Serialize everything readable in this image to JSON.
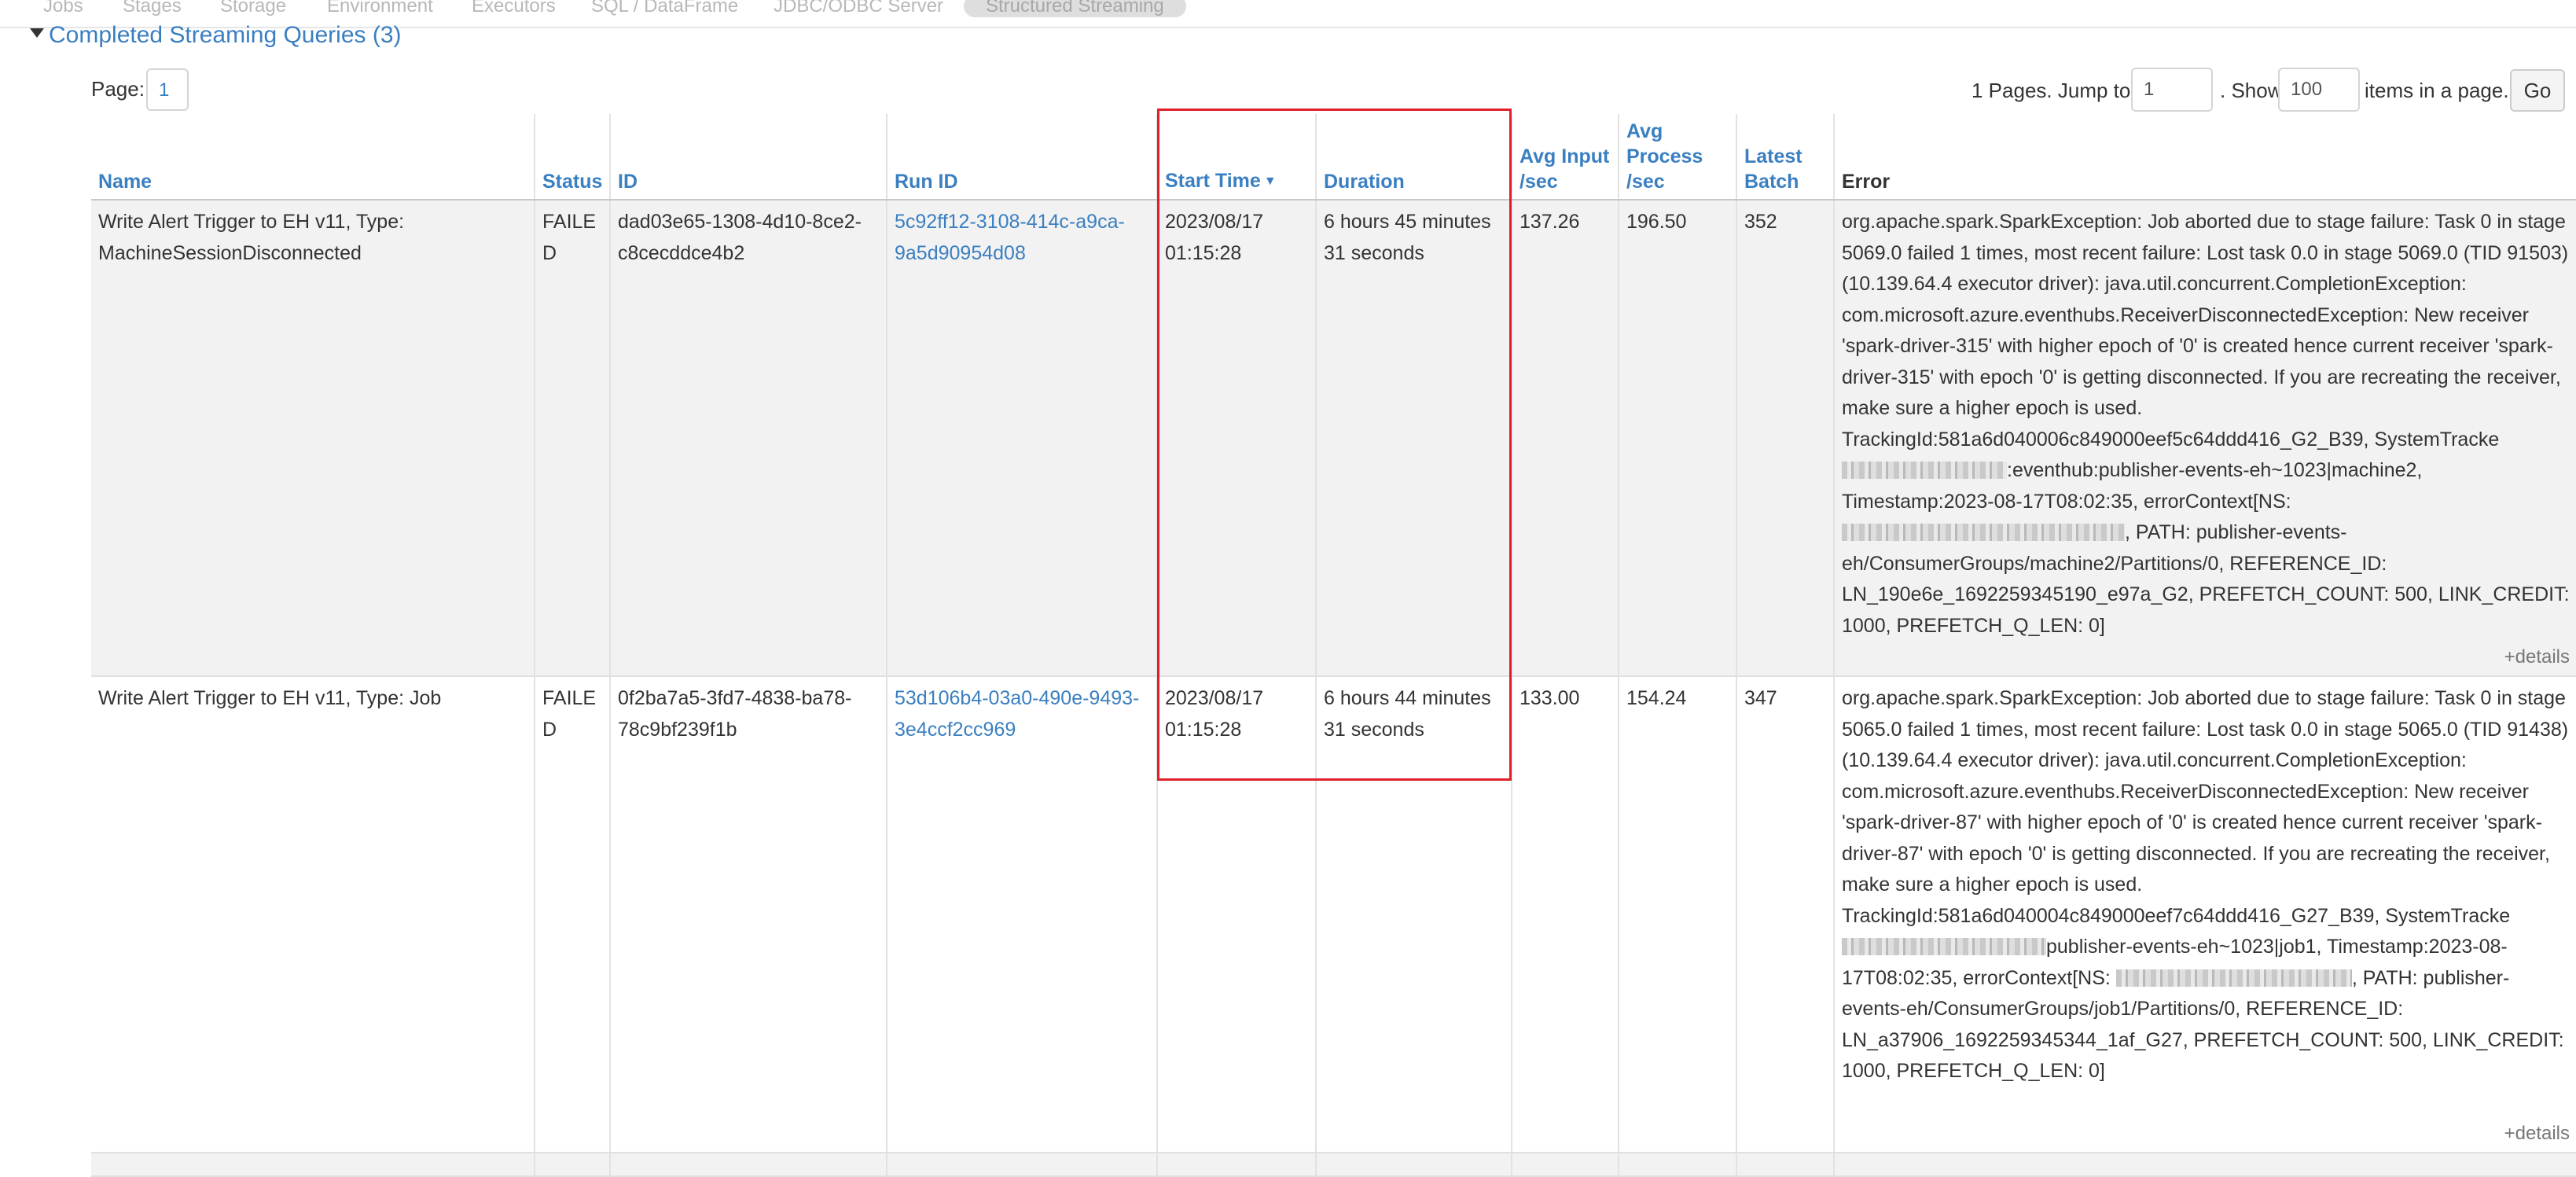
{
  "nav": {
    "tabs": [
      {
        "label": "Jobs"
      },
      {
        "label": "Stages"
      },
      {
        "label": "Storage"
      },
      {
        "label": "Environment"
      },
      {
        "label": "Executors"
      },
      {
        "label": "SQL / DataFrame"
      },
      {
        "label": "JDBC/ODBC Server"
      },
      {
        "label": "Structured Streaming"
      }
    ],
    "active_tab": "Structured Streaming"
  },
  "section": {
    "title": "Completed Streaming Queries (3)"
  },
  "paging": {
    "page_label": "Page:",
    "current_page": "1",
    "pages_text": "1 Pages. Jump to",
    "jump_value": "1",
    "show_text": ". Show",
    "show_value": "100",
    "items_text": "items in a page.",
    "go_label": "Go"
  },
  "table": {
    "headers": {
      "name": "Name",
      "status": "Status",
      "id": "ID",
      "run_id": "Run ID",
      "start_time": "Start Time",
      "sort_indicator": "▼",
      "duration": "Duration",
      "avg_input_1": "Avg Input",
      "avg_input_2": "/sec",
      "avg_process_1": "Avg Process",
      "avg_process_2": "/sec",
      "latest_batch_1": "Latest",
      "latest_batch_2": "Batch",
      "error": "Error"
    },
    "rows": [
      {
        "name": "Write Alert Trigger to EH v11, Type: MachineSessionDisconnected",
        "status": "FAILED",
        "id": "dad03e65-1308-4d10-8ce2-c8cecddce4b2",
        "run_id": "5c92ff12-3108-414c-a9ca-9a5d90954d08",
        "start_time": "2023/08/17 01:15:28",
        "duration": "6 hours 45 minutes 31 seconds",
        "avg_input": "137.26",
        "avg_process": "196.50",
        "latest_batch": "352",
        "error_a": "org.apache.spark.SparkException: Job aborted due to stage failure: Task 0 in stage 5069.0 failed 1 times, most recent failure: Lost task 0.0 in stage 5069.0 (TID 91503) (10.139.64.4 executor driver): java.util.concurrent.CompletionException: com.microsoft.azure.eventhubs.ReceiverDisconnectedException: New receiver 'spark-driver-315' with higher epoch of '0' is created hence current receiver 'spark-driver-315' with epoch '0' is getting disconnected. If you are recreating the receiver, make sure a higher epoch is used. TrackingId:581a6d040006c849000eef5c64ddd416_G2_B39, SystemTracke",
        "error_b": ":eventhub:publisher-events-eh~1023|machine2, Timestamp:2023-08-17T08:02:35, errorContext[NS:",
        "error_c": ", PATH: publisher-events-eh/ConsumerGroups/machine2/Partitions/0, REFERENCE_ID: LN_190e6e_1692259345190_e97a_G2, PREFETCH_COUNT: 500, LINK_CREDIT: 1000, PREFETCH_Q_LEN: 0]",
        "details": "+details"
      },
      {
        "name": "Write Alert Trigger to EH v11, Type: Job",
        "status": "FAILED",
        "id": "0f2ba7a5-3fd7-4838-ba78-78c9bf239f1b",
        "run_id": "53d106b4-03a0-490e-9493-3e4ccf2cc969",
        "start_time": "2023/08/17 01:15:28",
        "duration": "6 hours 44 minutes 31 seconds",
        "avg_input": "133.00",
        "avg_process": "154.24",
        "latest_batch": "347",
        "error_a": "org.apache.spark.SparkException: Job aborted due to stage failure: Task 0 in stage 5065.0 failed 1 times, most recent failure: Lost task 0.0 in stage 5065.0 (TID 91438) (10.139.64.4 executor driver): java.util.concurrent.CompletionException: com.microsoft.azure.eventhubs.ReceiverDisconnectedException: New receiver 'spark-driver-87' with higher epoch of '0' is created hence current receiver 'spark-driver-87' with epoch '0' is getting disconnected. If you are recreating the receiver, make sure a higher epoch is used. TrackingId:581a6d040004c849000eef7c64ddd416_G27_B39, SystemTracke",
        "error_b": "publisher-events-eh~1023|job1, Timestamp:2023-08-17T08:02:35, errorContext[NS:",
        "error_c": ", PATH: publisher-events-eh/ConsumerGroups/job1/Partitions/0, REFERENCE_ID: LN_a37906_1692259345344_1af_G27, PREFETCH_COUNT: 500, LINK_CREDIT: 1000, PREFETCH_Q_LEN: 0]",
        "details": "+details"
      }
    ]
  }
}
